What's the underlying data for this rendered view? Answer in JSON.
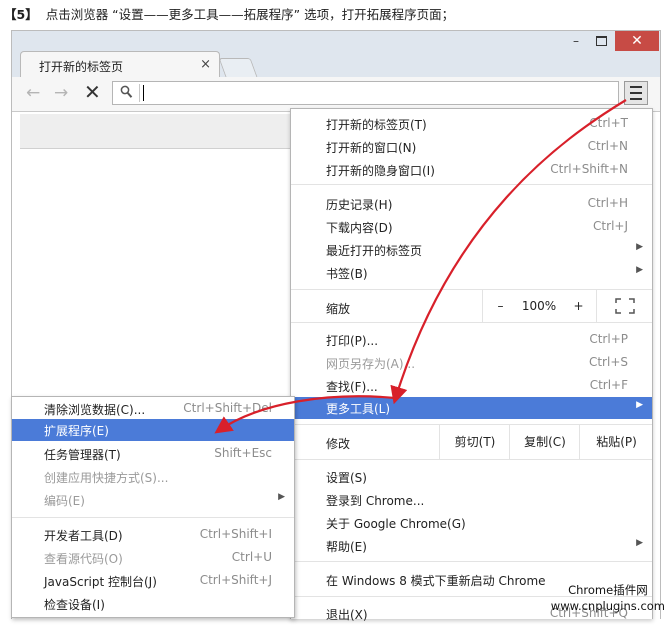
{
  "instruction": {
    "step": "【5】",
    "text": "点击浏览器 “设置——更多工具——拓展程序” 选项，打开拓展程序页面；"
  },
  "window_controls": {
    "minimize": "–",
    "close": "✕"
  },
  "tab": {
    "title": "打开新的标签页",
    "close": "×"
  },
  "toolbar": {
    "back": "←",
    "forward": "→",
    "stop": "✕",
    "search_icon": "magnifier-icon",
    "menu_icon": "hamburger-icon"
  },
  "menu": {
    "group1": [
      {
        "label": "打开新的标签页(T)",
        "shortcut": "Ctrl+T"
      },
      {
        "label": "打开新的窗口(N)",
        "shortcut": "Ctrl+N"
      },
      {
        "label": "打开新的隐身窗口(I)",
        "shortcut": "Ctrl+Shift+N"
      }
    ],
    "group2": [
      {
        "label": "历史记录(H)",
        "shortcut": "Ctrl+H"
      },
      {
        "label": "下载内容(D)",
        "shortcut": "Ctrl+J"
      },
      {
        "label": "最近打开的标签页",
        "arrow": "▶"
      },
      {
        "label": "书签(B)",
        "arrow": "▶"
      }
    ],
    "zoom": {
      "label": "缩放",
      "minus": "–",
      "value": "100%",
      "plus": "+",
      "fullscreen_icon": "fullscreen-icon"
    },
    "group3": [
      {
        "label": "打印(P)...",
        "shortcut": "Ctrl+P"
      },
      {
        "label": "网页另存为(A)...",
        "shortcut": "Ctrl+S"
      },
      {
        "label": "查找(F)...",
        "shortcut": "Ctrl+F"
      },
      {
        "label": "更多工具(L)",
        "arrow": "▶"
      }
    ],
    "edit": {
      "label": "修改",
      "cut": "剪切(T)",
      "copy": "复制(C)",
      "paste": "粘贴(P)"
    },
    "group4": [
      {
        "label": "设置(S)"
      },
      {
        "label": "登录到 Chrome..."
      },
      {
        "label": "关于 Google Chrome(G)"
      },
      {
        "label": "帮助(E)",
        "arrow": "▶"
      }
    ],
    "relaunch": "在 Windows 8 模式下重新启动 Chrome",
    "exit": {
      "label": "退出(X)",
      "shortcut": "Ctrl+Shift+Q"
    }
  },
  "submenu": {
    "group1": [
      {
        "label": "清除浏览数据(C)...",
        "shortcut": "Ctrl+Shift+Del"
      },
      {
        "label": "扩展程序(E)"
      },
      {
        "label": "任务管理器(T)",
        "shortcut": "Shift+Esc"
      },
      {
        "label": "创建应用快捷方式(S)..."
      },
      {
        "label": "编码(E)",
        "arrow": "▶"
      }
    ],
    "group2": [
      {
        "label": "开发者工具(D)",
        "shortcut": "Ctrl+Shift+I"
      },
      {
        "label": "查看源代码(O)",
        "shortcut": "Ctrl+U"
      },
      {
        "label": "JavaScript 控制台(J)",
        "shortcut": "Ctrl+Shift+J"
      },
      {
        "label": "检查设备(I)"
      }
    ]
  },
  "watermark": {
    "line1": "Chrome插件网",
    "line2": "www.cnplugins.com"
  },
  "colors": {
    "highlight": "#4b7bd8",
    "arrow": "#d8202a",
    "close_button": "#c74b45"
  }
}
